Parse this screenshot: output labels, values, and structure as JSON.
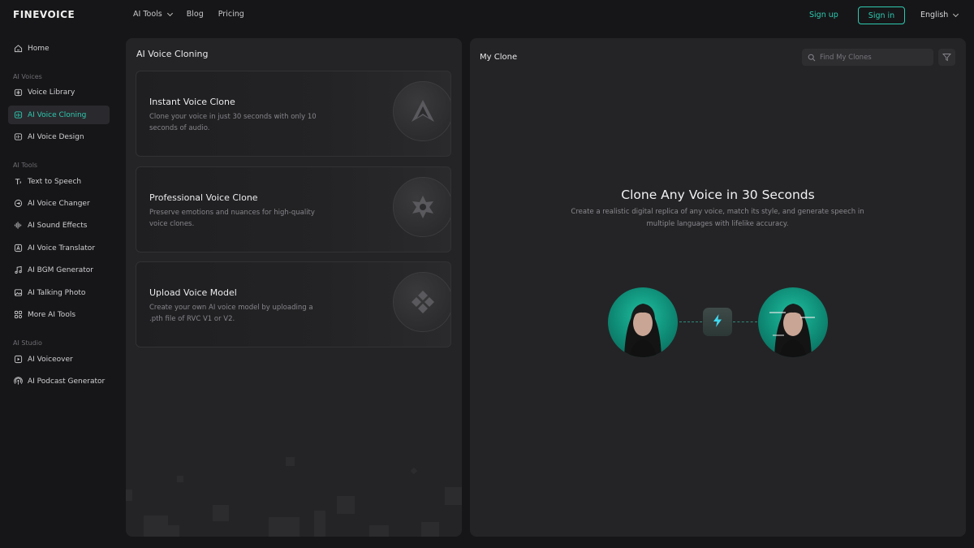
{
  "app": {
    "logo": "FINEVOICE"
  },
  "topnav": {
    "ai_tools": "AI Tools",
    "blog": "Blog",
    "pricing": "Pricing"
  },
  "auth": {
    "sign_up": "Sign up",
    "sign_in": "Sign in",
    "language": "English"
  },
  "sidebar": {
    "home": "Home",
    "section_voices": "AI Voices",
    "voice_library": "Voice Library",
    "voice_cloning": "AI Voice Cloning",
    "voice_design": "AI Voice Design",
    "section_tools": "AI Tools",
    "text_to_speech": "Text to Speech",
    "voice_changer": "AI Voice Changer",
    "sound_effects": "AI Sound Effects",
    "voice_translator": "AI Voice Translator",
    "bgm_generator": "AI BGM Generator",
    "talking_photo": "AI Talking Photo",
    "more_tools": "More AI Tools",
    "section_studio": "AI Studio",
    "voiceover": "AI Voiceover",
    "podcast_generator": "AI Podcast Generator"
  },
  "left_panel": {
    "title": "AI Voice Cloning",
    "cards": [
      {
        "title": "Instant Voice Clone",
        "desc": "Clone your voice in just 30 seconds with only 10 seconds of audio."
      },
      {
        "title": "Professional Voice Clone",
        "desc": "Preserve emotions and nuances for high-quality voice clones."
      },
      {
        "title": "Upload Voice Model",
        "desc": "Create your own AI voice model by uploading a .pth file of RVC V1 or V2."
      }
    ]
  },
  "right_panel": {
    "title": "My Clone",
    "search_placeholder": "Find My Clones",
    "hero_title": "Clone Any Voice in 30 Seconds",
    "hero_desc": "Create a realistic digital replica of any voice, match its style, and generate speech in multiple languages with lifelike accuracy."
  },
  "colors": {
    "accent": "#2ec9b0",
    "background": "#161618",
    "panel": "#242426"
  }
}
